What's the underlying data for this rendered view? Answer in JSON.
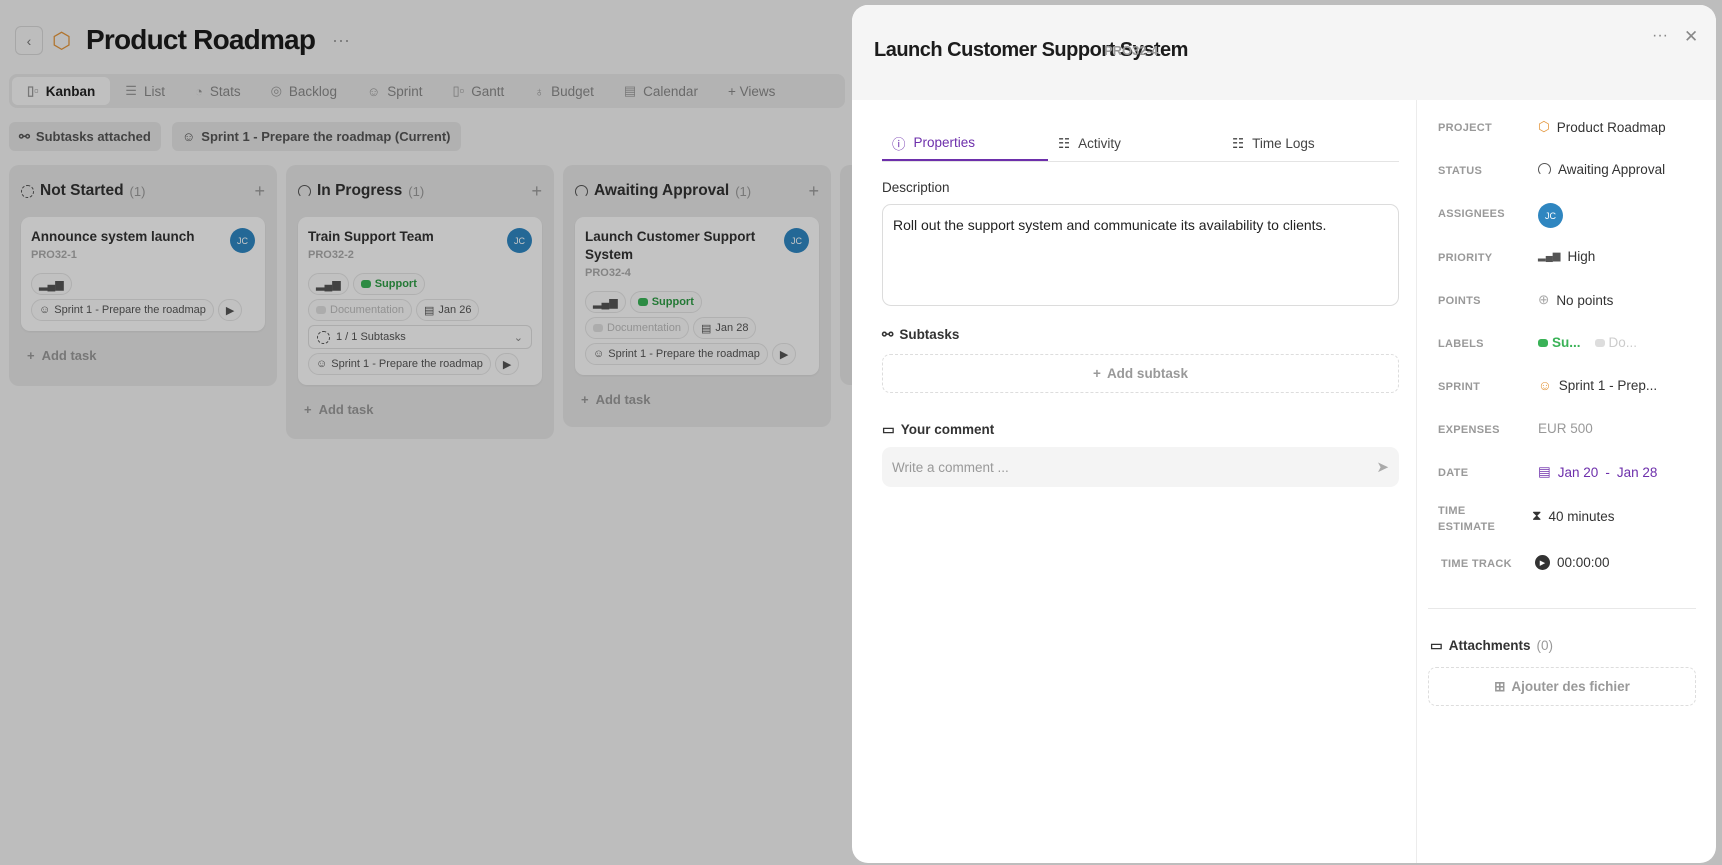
{
  "page": {
    "title": "Product Roadmap",
    "more": "···",
    "back": "‹"
  },
  "views": [
    "Kanban",
    "List",
    "Stats",
    "Backlog",
    "Sprint",
    "Gantt",
    "Budget",
    "Calendar",
    "+ Views"
  ],
  "filters": {
    "subtasks": "Subtasks attached",
    "sprint": "Sprint 1 - Prepare the roadmap (Current)"
  },
  "columns": [
    {
      "name": "Not Started",
      "count": "(1)",
      "add": "Add task",
      "cards": [
        {
          "title": "Announce system launch",
          "id": "PRO32-1",
          "avatar": "JC",
          "sprint": "Sprint 1 - Prepare the roadmap"
        }
      ]
    },
    {
      "name": "In Progress",
      "count": "(1)",
      "add": "Add task",
      "cards": [
        {
          "title": "Train Support Team",
          "id": "PRO32-2",
          "avatar": "JC",
          "label1": "Support",
          "label2": "Documentation",
          "date": "Jan 26",
          "subtasks": "1 / 1 Subtasks",
          "sprint": "Sprint 1 - Prepare the roadmap"
        }
      ]
    },
    {
      "name": "Awaiting Approval",
      "count": "(1)",
      "add": "Add task",
      "cards": [
        {
          "title": "Launch Customer Support System",
          "id": "PRO32-4",
          "avatar": "JC",
          "label1": "Support",
          "label2": "Documentation",
          "date": "Jan 28",
          "sprint": "Sprint 1 - Prepare the roadmap"
        }
      ]
    }
  ],
  "task": {
    "title": "Launch Customer Support System",
    "id": "PRO32-4",
    "tabs": [
      "Properties",
      "Activity",
      "Time Logs"
    ],
    "description_label": "Description",
    "description": "Roll out the support system and communicate its availability to clients.",
    "subtasks_label": "Subtasks",
    "add_subtask": "Add subtask",
    "comment_label": "Your comment",
    "comment_placeholder": "Write a comment ...",
    "props": {
      "project_label": "PROJECT",
      "project": "Product Roadmap",
      "status_label": "STATUS",
      "status": "Awaiting Approval",
      "assignees_label": "ASSIGNEES",
      "assignee": "JC",
      "priority_label": "PRIORITY",
      "priority": "High",
      "points_label": "POINTS",
      "points": "No points",
      "labels_label": "LABELS",
      "label1": "Su...",
      "label2": "Do...",
      "sprint_label": "SPRINT",
      "sprint": "Sprint 1 - Prep...",
      "expenses_label": "EXPENSES",
      "expenses": "EUR 500",
      "date_label": "DATE",
      "date_start": "Jan 20",
      "date_sep": "-",
      "date_end": "Jan 28",
      "estimate_label1": "TIME",
      "estimate_label2": "ESTIMATE",
      "estimate": "40 minutes",
      "track_label": "TIME TRACK",
      "track": "00:00:00"
    },
    "attachments_label": "Attachments",
    "attachments_count": "(0)",
    "add_file": "Ajouter des fichier"
  },
  "colors": {
    "accent": "#6d2fab",
    "green": "#3ab257",
    "avatar": "#2f86c0",
    "sprint": "#e3953a"
  }
}
